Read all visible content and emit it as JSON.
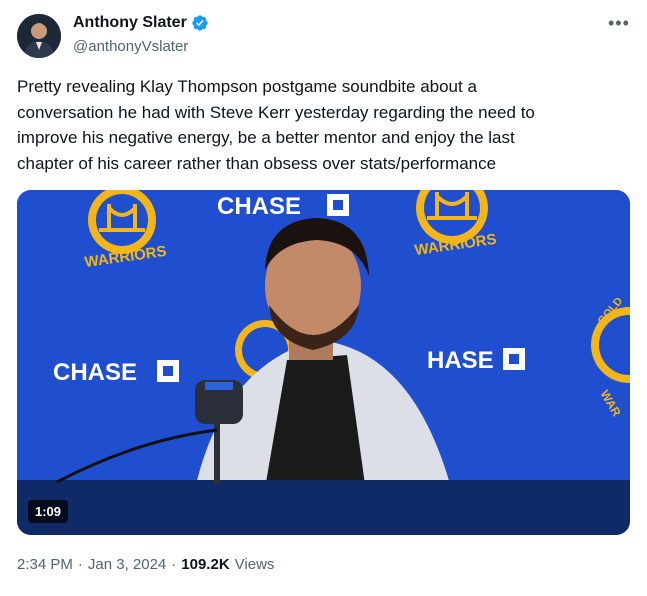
{
  "author": {
    "name": "Anthony Slater",
    "handle": "@anthonyVslater",
    "verified": true
  },
  "tweet": {
    "text": "Pretty revealing Klay Thompson postgame soundbite about a\nconversation he had with Steve Kerr yesterday regarding the need to\nimprove his negative energy, be a better mentor and enjoy the last\nchapter of his career rather than obsess over stats/performance",
    "more_icon": "more-horizontal-icon"
  },
  "media": {
    "duration": "1:09",
    "backdrop_texts": {
      "sponsor_top": "CHASE",
      "sponsor_left": "CHASE",
      "sponsor_right": "HASE",
      "team_word": "WARRIORS",
      "team_word_partial": "WAR",
      "gold_partial": "GOLD"
    }
  },
  "meta": {
    "time": "2:34 PM",
    "date": "Jan 3, 2024",
    "views_count": "109.2K",
    "views_label": "Views",
    "separator": "·"
  },
  "colors": {
    "accent_blue": "#1d9bf0",
    "backdrop_blue": "#1f4fcf",
    "warriors_gold": "#f2b51a",
    "text_secondary": "#536471"
  }
}
